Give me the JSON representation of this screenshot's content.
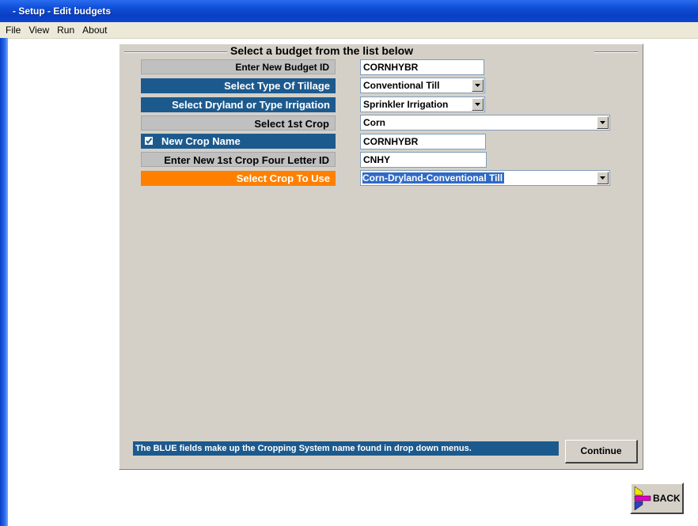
{
  "window": {
    "title": "- Setup - Edit budgets"
  },
  "menu": [
    "File",
    "View",
    "Run",
    "About"
  ],
  "group_title": "Select a budget from the list below",
  "rows": {
    "budget_id": {
      "label": "Enter New Budget ID",
      "value": "CORNHYBR"
    },
    "tillage": {
      "label": "Select Type Of Tillage",
      "value": "Conventional Till"
    },
    "irrigation": {
      "label": "Select Dryland or Type Irrigation",
      "value": "Sprinkler Irrigation"
    },
    "first_crop": {
      "label": "Select 1st Crop",
      "value": "Corn"
    },
    "new_crop_name": {
      "label": "New Crop Name",
      "value": "CORNHYBR",
      "checked": true
    },
    "four_letter_id": {
      "label": "Enter New 1st Crop Four Letter ID",
      "value": "CNHY"
    },
    "crop_to_use": {
      "label": "Select Crop To Use",
      "value": "Corn-Dryland-Conventional Till"
    }
  },
  "status_text": "The BLUE fields make up the Cropping System name found in drop down menus.",
  "continue_label": "Continue",
  "back_label": "BACK",
  "colors": {
    "blue_field": "#1c5a8e",
    "orange_field": "#ff8000",
    "panel": "#d4d0c8",
    "titlebar": "#0a3fc2"
  }
}
